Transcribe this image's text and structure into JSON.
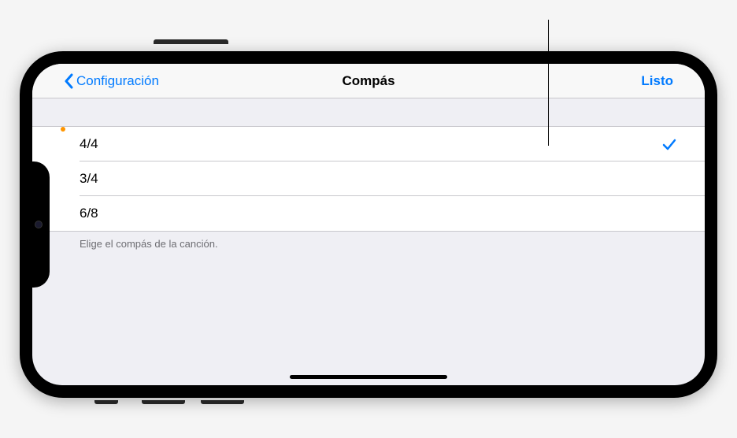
{
  "nav": {
    "back_label": "Configuración",
    "title": "Compás",
    "done_label": "Listo"
  },
  "options": [
    {
      "label": "4/4",
      "selected": true
    },
    {
      "label": "3/4",
      "selected": false
    },
    {
      "label": "6/8",
      "selected": false
    }
  ],
  "footer": "Elige el compás de la canción."
}
